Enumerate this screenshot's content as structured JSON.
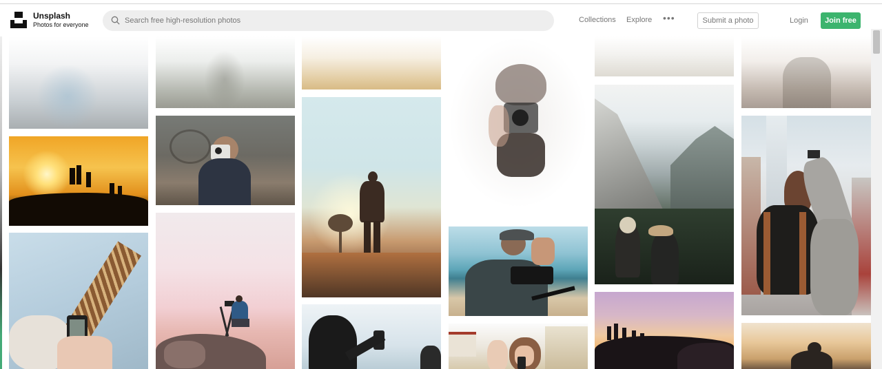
{
  "brand": {
    "name": "Unsplash",
    "tagline": "Photos for everyone"
  },
  "search": {
    "placeholder": "Search free high-resolution photos"
  },
  "nav": {
    "collections": "Collections",
    "explore": "Explore",
    "more": "•••",
    "submit": "Submit a photo",
    "login": "Login",
    "join": "Join free"
  },
  "colors": {
    "accent": "#3cb46e",
    "search_bg": "#eeeeee",
    "nav_text": "#777777"
  },
  "photos": [
    {
      "name": "photo-misty-person",
      "desc_icon": "photo-icon"
    },
    {
      "name": "photo-sunset-hilltop-silhouettes"
    },
    {
      "name": "photo-hand-holding-phone"
    },
    {
      "name": "photo-misty-forest"
    },
    {
      "name": "photo-photographer-instant-camera"
    },
    {
      "name": "photo-tripod-photographer-on-rock"
    },
    {
      "name": "photo-warm-field-top"
    },
    {
      "name": "photo-man-silhouette-field"
    },
    {
      "name": "photo-phone-selfie-silhouette"
    },
    {
      "name": "photo-camera-hands-overlay"
    },
    {
      "name": "photo-videographer-beach"
    },
    {
      "name": "photo-woman-taking-photo-field"
    },
    {
      "name": "photo-faded-top"
    },
    {
      "name": "photo-mountain-hikers"
    },
    {
      "name": "photo-silhouettes-dusk-ridge"
    },
    {
      "name": "photo-faded-person"
    },
    {
      "name": "photo-woman-backpack-city"
    },
    {
      "name": "photo-sunset-photographer"
    }
  ]
}
